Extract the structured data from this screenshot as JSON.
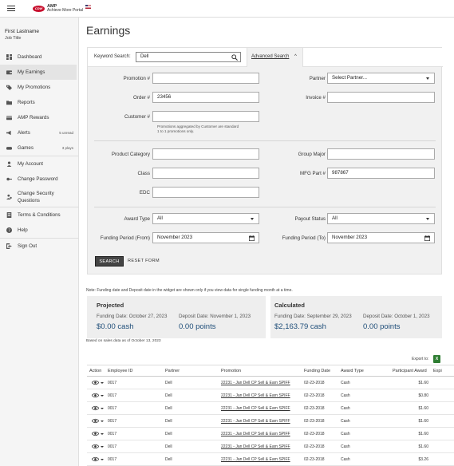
{
  "header": {
    "logo_brand": "CDW",
    "app_name": "AMP",
    "app_subtitle": "Achieve More Portal"
  },
  "user": {
    "name": "First Lastname",
    "title": "Job Title"
  },
  "sidebar": {
    "items": [
      {
        "label": "Dashboard",
        "icon": "dashboard-icon"
      },
      {
        "label": "My Earnings",
        "icon": "wallet-icon",
        "active": true
      },
      {
        "label": "My Promotions",
        "icon": "tag-icon"
      },
      {
        "label": "Reports",
        "icon": "folder-icon"
      },
      {
        "label": "AMP Rewards",
        "icon": "card-icon"
      },
      {
        "label": "Alerts",
        "icon": "megaphone-icon",
        "badge": "5 unread"
      },
      {
        "label": "Games",
        "icon": "gamepad-icon",
        "badge": "3 plays"
      },
      {
        "label": "My Account",
        "icon": "person-icon"
      },
      {
        "label": "Change Password",
        "icon": "key-icon"
      },
      {
        "label": "Change Security Questions",
        "icon": "security-user-icon"
      },
      {
        "label": "Terms & Conditions",
        "icon": "document-icon"
      },
      {
        "label": "Help",
        "icon": "help-icon"
      },
      {
        "label": "Sign Out",
        "icon": "sign-out-icon"
      }
    ]
  },
  "page": {
    "title": "Earnings"
  },
  "filters": {
    "keyword_label": "Keyword Search:",
    "keyword_value": "Dell",
    "advanced_label": "Advanced Search",
    "promotion_label": "Promotion #",
    "promotion_value": "",
    "partner_label": "Partner",
    "partner_value": "Select Partner...",
    "order_label": "Order #",
    "order_value": "23456",
    "invoice_label": "Invoice #",
    "invoice_value": "",
    "customer_label": "Customer #",
    "customer_value": "",
    "customer_hint_1": "Promotions aggregated by Customer are standard",
    "customer_hint_2": "1 to 1 promotions only.",
    "product_category_label": "Product Category",
    "product_category_value": "",
    "group_major_label": "Group Major",
    "group_major_value": "",
    "class_label": "Class",
    "class_value": "",
    "mfg_part_label": "MFG Part #",
    "mfg_part_value": "987867",
    "edc_label": "EDC",
    "edc_value": "",
    "award_type_label": "Award Type",
    "award_type_value": "All",
    "payout_status_label": "Payout Status",
    "payout_status_value": "All",
    "funding_from_label": "Funding Period (From)",
    "funding_from_value": "November 2023",
    "funding_to_label": "Funding Period (To)",
    "funding_to_value": "November 2023",
    "search_button": "SEARCH",
    "reset_button": "RESET FORM"
  },
  "note": "Note: Funding date and Deposit date in the widget are shown only if you view data for single funding month at a time.",
  "summary": {
    "projected": {
      "heading": "Projected",
      "funding_date": "Funding Date: October 27, 2023",
      "deposit_date": "Deposit Date: November 1, 2023",
      "cash": "$0.00 cash",
      "points": "0.00 points"
    },
    "calculated": {
      "heading": "Calculated",
      "funding_date": "Funding Date: September 29, 2023",
      "deposit_date": "Deposit Date: October 1, 2023",
      "cash": "$2,163.79 cash",
      "points": "0.00 points"
    },
    "based_on": "Based on sales data as of October 13, 2023"
  },
  "export": {
    "label": "Export to:",
    "icon": "excel-icon"
  },
  "table": {
    "columns": [
      "Action",
      "Employee ID",
      "Partner",
      "Promotion",
      "Funding Date",
      "Award Type",
      "Participant Award",
      "Expi"
    ],
    "rows": [
      {
        "employee_id": "0017",
        "partner": "Dell",
        "promotion": "22231 - Jan Dell CP Sell & Earn SPIFF",
        "funding_date": "02-23-2018",
        "award_type": "Cash",
        "award": "$1.60"
      },
      {
        "employee_id": "0017",
        "partner": "Dell",
        "promotion": "22231 - Jan Dell CP Sell & Earn SPIFF",
        "funding_date": "02-23-2018",
        "award_type": "Cash",
        "award": "$0.80"
      },
      {
        "employee_id": "0017",
        "partner": "Dell",
        "promotion": "22231 - Jan Dell CP Sell & Earn SPIFF",
        "funding_date": "02-23-2018",
        "award_type": "Cash",
        "award": "$1.60"
      },
      {
        "employee_id": "0017",
        "partner": "Dell",
        "promotion": "22231 - Jan Dell CP Sell & Earn SPIFF",
        "funding_date": "02-23-2018",
        "award_type": "Cash",
        "award": "$1.60"
      },
      {
        "employee_id": "0017",
        "partner": "Dell",
        "promotion": "22231 - Jan Dell CP Sell & Earn SPIFF",
        "funding_date": "02-23-2018",
        "award_type": "Cash",
        "award": "$1.60"
      },
      {
        "employee_id": "0017",
        "partner": "Dell",
        "promotion": "22231 - Jan Dell CP Sell & Earn SPIFF",
        "funding_date": "02-23-2018",
        "award_type": "Cash",
        "award": "$1.60"
      },
      {
        "employee_id": "0017",
        "partner": "Dell",
        "promotion": "22231 - Jan Dell CP Sell & Earn SPIFF",
        "funding_date": "02-23-2018",
        "award_type": "Cash",
        "award": "$3.26"
      }
    ]
  },
  "colors": {
    "accent_value": "#1f4e79",
    "search_button_bg": "#444444",
    "brand_red": "#c8102e"
  }
}
